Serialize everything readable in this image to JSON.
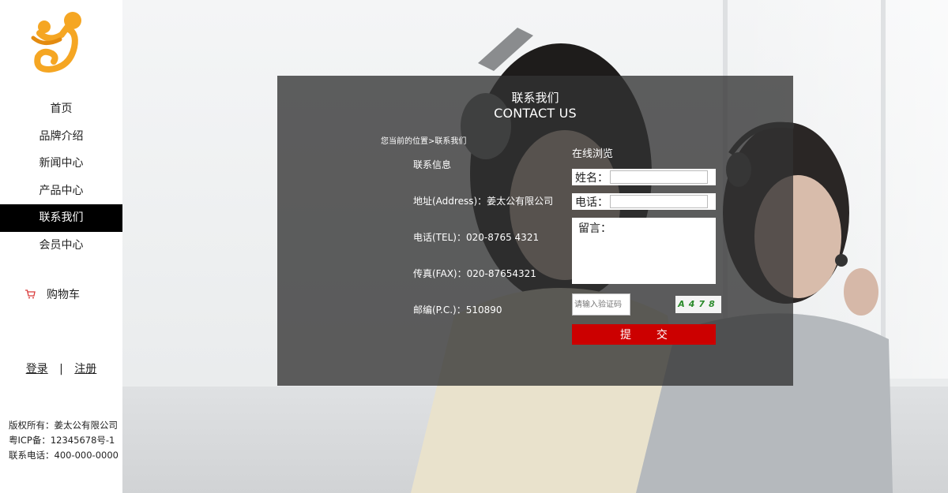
{
  "nav": [
    "首页",
    "品牌介绍",
    "新闻中心",
    "产品中心",
    "联系我们",
    "会员中心"
  ],
  "nav_active": 4,
  "cart_label": "购物车",
  "auth": {
    "login": "登录",
    "sep": "|",
    "register": "注册"
  },
  "footer": [
    "版权所有：姜太公有限公司",
    "粤ICP备：12345678号-1",
    "联系电话：400-000-0000"
  ],
  "panel": {
    "title_cn": "联系我们",
    "title_en": "CONTACT US",
    "breadcrumb": "您当前的位置>联系我们",
    "info": [
      "联系信息",
      "地址(Address)：姜太公有限公司",
      "电话(TEL)：020-8765 4321",
      "传真(FAX)：020-87654321",
      "邮编(P.C.)：510890"
    ]
  },
  "form": {
    "title": "在线浏览",
    "name_label": "姓名：",
    "phone_label": "电话：",
    "message_label": "留言：",
    "captcha_placeholder": "请输入验证码",
    "captcha_text": "A478",
    "submit_label": "提 交"
  },
  "colors": {
    "active_nav_bg": "#000000",
    "submit_bg": "#cc0000",
    "panel_bg": "rgba(50,50,50,0.78)",
    "logo": "#f5a623"
  },
  "icons": {
    "logo": "brand-logo",
    "cart": "cart-icon"
  }
}
